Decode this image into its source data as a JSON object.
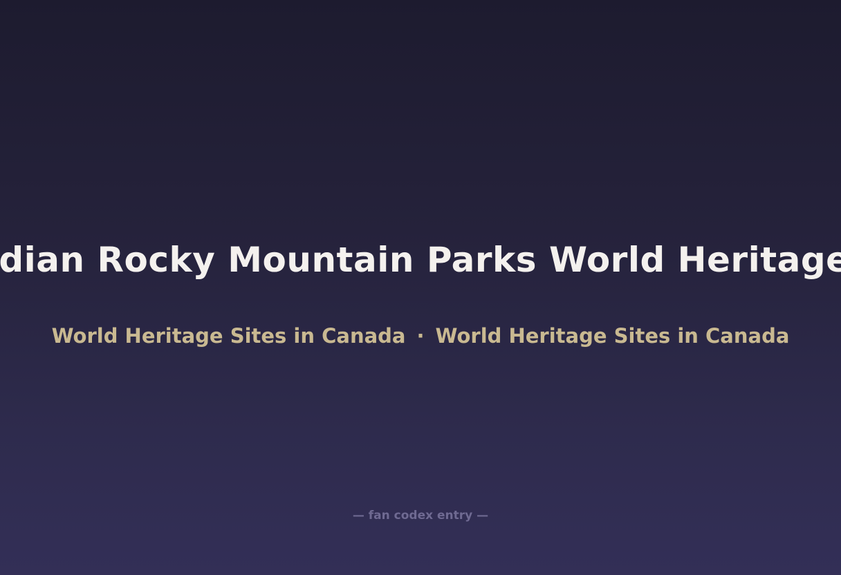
{
  "title": "Canadian Rocky Mountain Parks World Heritage Site",
  "subtitle": {
    "left": "World Heritage Sites in Canada",
    "separator": "·",
    "right": "World Heritage Sites in Canada"
  },
  "footer": "— fan codex entry —",
  "colors": {
    "title": "#f4f1ee",
    "subtitle": "#c9b991",
    "footer": "#6f6a92",
    "background_top": "#1d1b2f",
    "background_bottom": "#332f57"
  }
}
